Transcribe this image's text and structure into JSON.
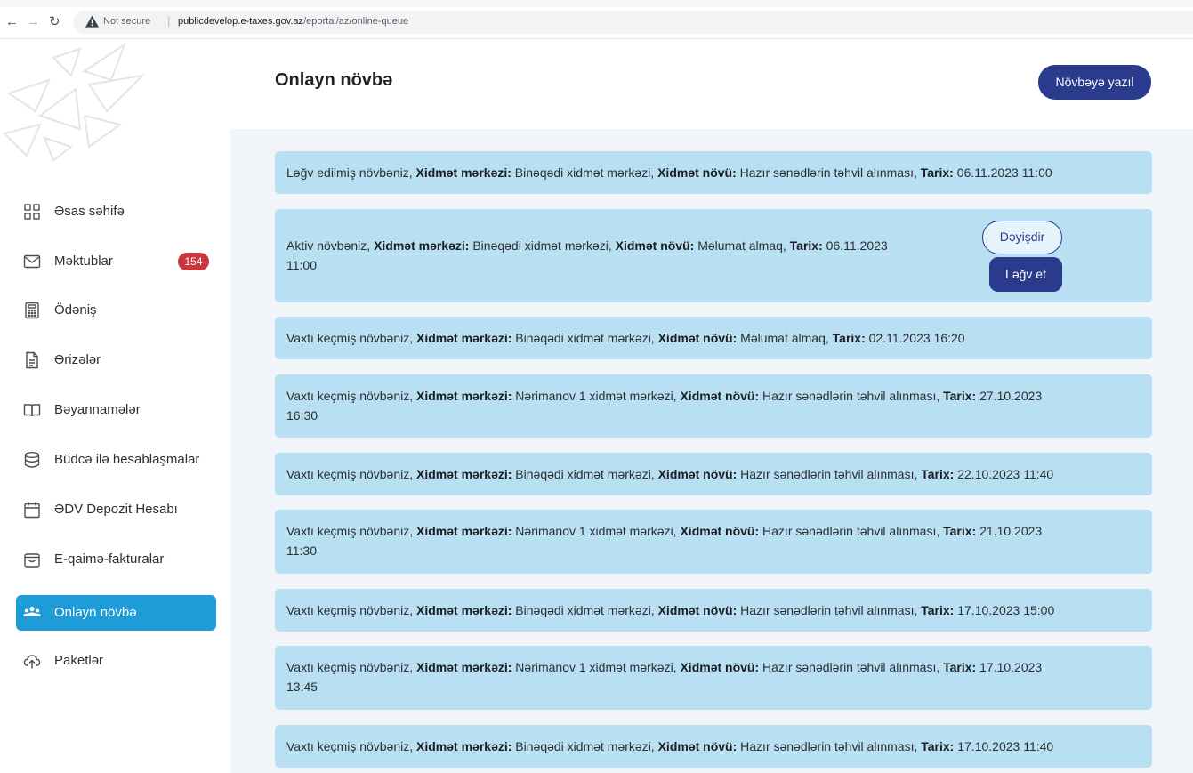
{
  "browser": {
    "security_label": "Not secure",
    "url_host": "publicdevelop.e-taxes.gov.az",
    "url_path": "/eportal/az/online-queue"
  },
  "sidebar": {
    "items": [
      {
        "label": "Əsas səhifə",
        "icon": "grid-icon"
      },
      {
        "label": "Məktublar",
        "icon": "mail-icon",
        "badge": "154"
      },
      {
        "label": "Ödəniş",
        "icon": "calculator-icon"
      },
      {
        "label": "Ərizələr",
        "icon": "document-icon"
      },
      {
        "label": "Bəyannamələr",
        "icon": "book-icon"
      },
      {
        "label": "Büdcə ilə hesablaşmalar",
        "icon": "database-icon"
      },
      {
        "label": "ƏDV Depozit Hesabı",
        "icon": "calendar-icon"
      },
      {
        "label": "E-qaimə-fakturalar",
        "icon": "bag-icon"
      },
      {
        "label": "Onlayn növbə",
        "icon": "users-icon",
        "active": true
      },
      {
        "label": "Paketlər",
        "icon": "cloud-upload-icon"
      }
    ]
  },
  "header": {
    "title": "Onlayn növbə",
    "enqueue_button": "Növbəyə yazıl"
  },
  "labels": {
    "center": "Xidmət mərkəzi:",
    "service": "Xidmət növü:",
    "date": "Tarix:"
  },
  "queue": [
    {
      "status": "Ləğv edilmiş növbəniz,",
      "center": "Binəqədi xidmət mərkəzi,",
      "service": "Hazır sənədlərin təhvil alınması,",
      "date": "06.11.2023 11:00"
    },
    {
      "status": "Aktiv növbəniz,",
      "center": "Binəqədi xidmət mərkəzi,",
      "service": "Məlumat almaq,",
      "date_line1": "06.11.2023",
      "date_line2": "11:00",
      "change_button": "Dəyişdir",
      "cancel_button": "Ləğv et"
    },
    {
      "status": "Vaxtı keçmiş növbəniz,",
      "center": "Binəqədi xidmət mərkəzi,",
      "service": "Məlumat almaq,",
      "date": "02.11.2023 16:20"
    },
    {
      "status": "Vaxtı keçmiş növbəniz,",
      "center": "Nərimanov 1 xidmət mərkəzi,",
      "service": "Hazır sənədlərin təhvil alınması,",
      "date_line1": "27.10.2023",
      "date_line2": "16:30"
    },
    {
      "status": "Vaxtı keçmiş növbəniz,",
      "center": "Binəqədi xidmət mərkəzi,",
      "service": "Hazır sənədlərin təhvil alınması,",
      "date": "22.10.2023 11:40"
    },
    {
      "status": "Vaxtı keçmiş növbəniz,",
      "center": "Nərimanov 1 xidmət mərkəzi,",
      "service": "Hazır sənədlərin təhvil alınması,",
      "date_line1": "21.10.2023",
      "date_line2": "11:30"
    },
    {
      "status": "Vaxtı keçmiş növbəniz,",
      "center": "Binəqədi xidmət mərkəzi,",
      "service": "Hazır sənədlərin təhvil alınması,",
      "date": "17.10.2023 15:00"
    },
    {
      "status": "Vaxtı keçmiş növbəniz,",
      "center": "Nərimanov 1 xidmət mərkəzi,",
      "service": "Hazır sənədlərin təhvil alınması,",
      "date_line1": "17.10.2023",
      "date_line2": "13:45"
    },
    {
      "status": "Vaxtı keçmiş növbəniz,",
      "center": "Binəqədi xidmət mərkəzi,",
      "service": "Hazır sənədlərin təhvil alınması,",
      "date": "17.10.2023 11:40"
    }
  ],
  "colors": {
    "accent": "#1e9cd8",
    "primary_button": "#2a3a8c",
    "card_bg": "#b9dff3",
    "badge": "#c8373d"
  }
}
